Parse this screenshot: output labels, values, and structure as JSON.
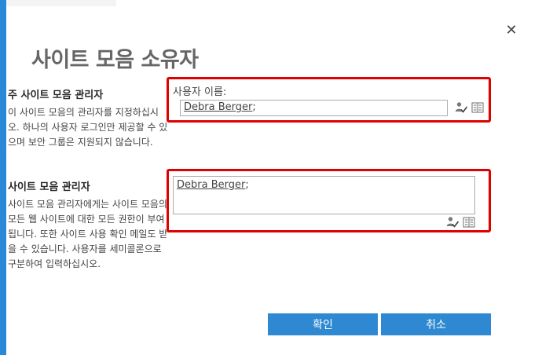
{
  "dialog": {
    "title": "사이트 모음 소유자",
    "close_glyph": "✕"
  },
  "primary_admin": {
    "heading": "주 사이트 모음 관리자",
    "description": "이 사이트 모음의 관리자를 지정하십시오. 하나의 사용자 로그인만 제공할 수 있으며 보안 그룹은 지원되지 않습니다.",
    "field_label": "사용자 이름:",
    "value": "Debra Berger",
    "separator": ";"
  },
  "site_admins": {
    "heading": "사이트 모음 관리자",
    "description": "사이트 모음 관리자에게는 사이트 모음의 모든 웹 사이트에 대한 모든 권한이 부여됩니다. 또한 사이트 사용 확인 메일도 받을 수 있습니다. 사용자를 세미콜론으로 구분하여 입력하십시오.",
    "value": "Debra Berger",
    "separator": ";"
  },
  "buttons": {
    "ok_label": "확인",
    "cancel_label": "취소"
  },
  "icons": {
    "check_names": "check-names-icon",
    "browse": "address-book-icon"
  },
  "colors": {
    "accent": "#2b88d8",
    "button": "#2e89d2",
    "highlight_border": "#e00000"
  }
}
